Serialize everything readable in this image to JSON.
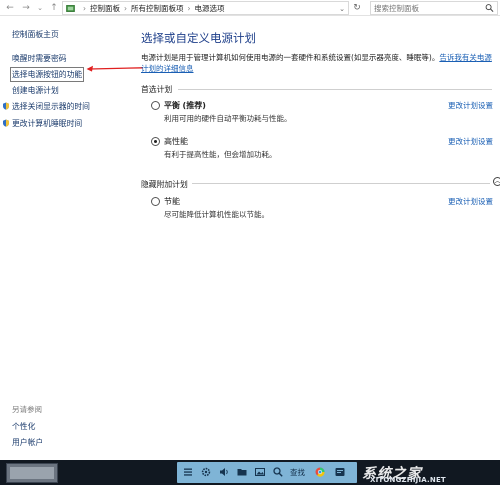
{
  "address_bar": {
    "breadcrumbs": [
      "控制面板",
      "所有控制面板项",
      "电源选项"
    ],
    "search_placeholder": "搜索控制面板"
  },
  "sidebar": {
    "home": "控制面板主页",
    "links": [
      "唤醒时需要密码",
      "选择电源按钮的功能",
      "创建电源计划",
      "选择关闭显示器的时间",
      "更改计算机睡眠时间"
    ],
    "see_also_title": "另请参阅",
    "see_also": [
      "个性化",
      "用户帐户"
    ]
  },
  "main": {
    "title": "选择或自定义电源计划",
    "description": "电源计划是用于管理计算机如何使用电源的一套硬件和系统设置(如显示器亮度、睡眠等)。",
    "description_link_part1": "告诉我有关",
    "description_link_part2": "电源计划的详细信息",
    "preferred_group": "首选计划",
    "hidden_group": "隐藏附加计划",
    "plans": [
      {
        "name": "平衡",
        "tag": "(推荐)",
        "desc": "利用可用的硬件自动平衡功耗与性能。",
        "checked": false,
        "link": "更改计划设置"
      },
      {
        "name": "高性能",
        "tag": "",
        "desc": "有利于提高性能，但会增加功耗。",
        "checked": true,
        "link": "更改计划设置"
      },
      {
        "name": "节能",
        "tag": "",
        "desc": "尽可能降低计算机性能以节能。",
        "checked": false,
        "link": "更改计划设置"
      }
    ]
  },
  "taskbar": {
    "tray_label": "查找",
    "watermark_top": "系统之家",
    "watermark_bottom": "XITONGZHIJIA.NET"
  },
  "colors": {
    "title_blue": "#1e3f8a",
    "link_blue": "#1a5fb4",
    "annotation_red": "#e02020",
    "taskbar": "#111821",
    "tray": "#7fb4d6"
  }
}
